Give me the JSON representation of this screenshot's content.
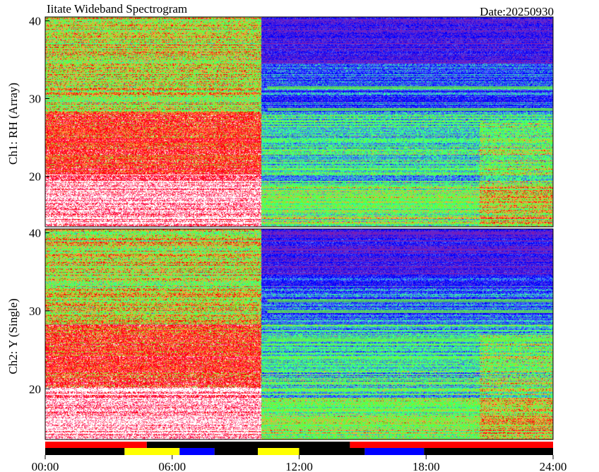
{
  "chart_data": {
    "type": "heatmap",
    "title": "Iitate Wideband Spectrogram",
    "date_label": "Date:20250930",
    "time_ticks": [
      "00:00",
      "06:00",
      "12:00",
      "18:00",
      "24:00"
    ],
    "time_range_hours": [
      0,
      24
    ],
    "panels": [
      {
        "name": "Ch1: RH (Array)",
        "ylim": [
          13.5,
          40.5
        ],
        "yticks": [
          20,
          30,
          40
        ],
        "tone_bands": [
          11.8,
          28.6,
          31.4
        ]
      },
      {
        "name": "Ch2: Y (Single)",
        "ylim": [
          13.5,
          40.5
        ],
        "yticks": [
          20,
          30,
          40
        ],
        "tone_bands": [
          26.3,
          29.9,
          31.3
        ]
      }
    ],
    "status_bars": {
      "top": [
        {
          "start": 0,
          "end": 4.8,
          "color": "#ff0000"
        },
        {
          "start": 4.8,
          "end": 14.4,
          "color": "#000000"
        },
        {
          "start": 14.4,
          "end": 24,
          "color": "#ff0000"
        }
      ],
      "bottom": [
        {
          "start": 0,
          "end": 3.75,
          "color": "#000000"
        },
        {
          "start": 3.75,
          "end": 6.35,
          "color": "#ffff00"
        },
        {
          "start": 6.35,
          "end": 8.0,
          "color": "#0000ff"
        },
        {
          "start": 8.0,
          "end": 10.05,
          "color": "#000000"
        },
        {
          "start": 10.05,
          "end": 12.0,
          "color": "#ffff00"
        },
        {
          "start": 12.0,
          "end": 15.1,
          "color": "#000000"
        },
        {
          "start": 15.1,
          "end": 17.9,
          "color": "#0000ff"
        },
        {
          "start": 17.9,
          "end": 24,
          "color": "#000000"
        }
      ]
    }
  }
}
